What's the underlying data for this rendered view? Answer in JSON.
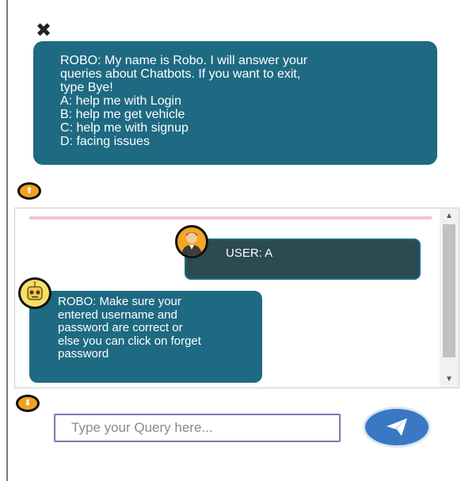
{
  "close": {
    "icon": "close-icon",
    "glyph": "✖"
  },
  "intro": {
    "lines": [
      "ROBO: My name is Robo. I will answer your",
      "queries about Chatbots. If you want to exit,",
      "type Bye!",
      "A: help me with Login",
      "B: help me get vehicle",
      "C: help me with signup",
      "D: facing issues"
    ]
  },
  "toggles": {
    "up_icon": "arrow-up-icon",
    "down_icon": "arrow-down-icon",
    "up_glyph": "⬆",
    "down_glyph": "⬇"
  },
  "messages": {
    "user": {
      "text": "USER: A",
      "avatar": "user-avatar-icon"
    },
    "bot": {
      "text": "ROBO: Make sure your\nentered username and\npassword are correct or\nelse you can click on forget\npassword",
      "avatar": "robot-avatar-icon"
    }
  },
  "input": {
    "placeholder": "Type your Query here...",
    "value": ""
  },
  "send": {
    "icon": "send-icon"
  },
  "colors": {
    "bubble": "#1e6a82",
    "user_bubble": "#2b4a52",
    "toggle": "#f0a21f",
    "send": "#3a78c3",
    "divider": "#f5c2c8"
  }
}
